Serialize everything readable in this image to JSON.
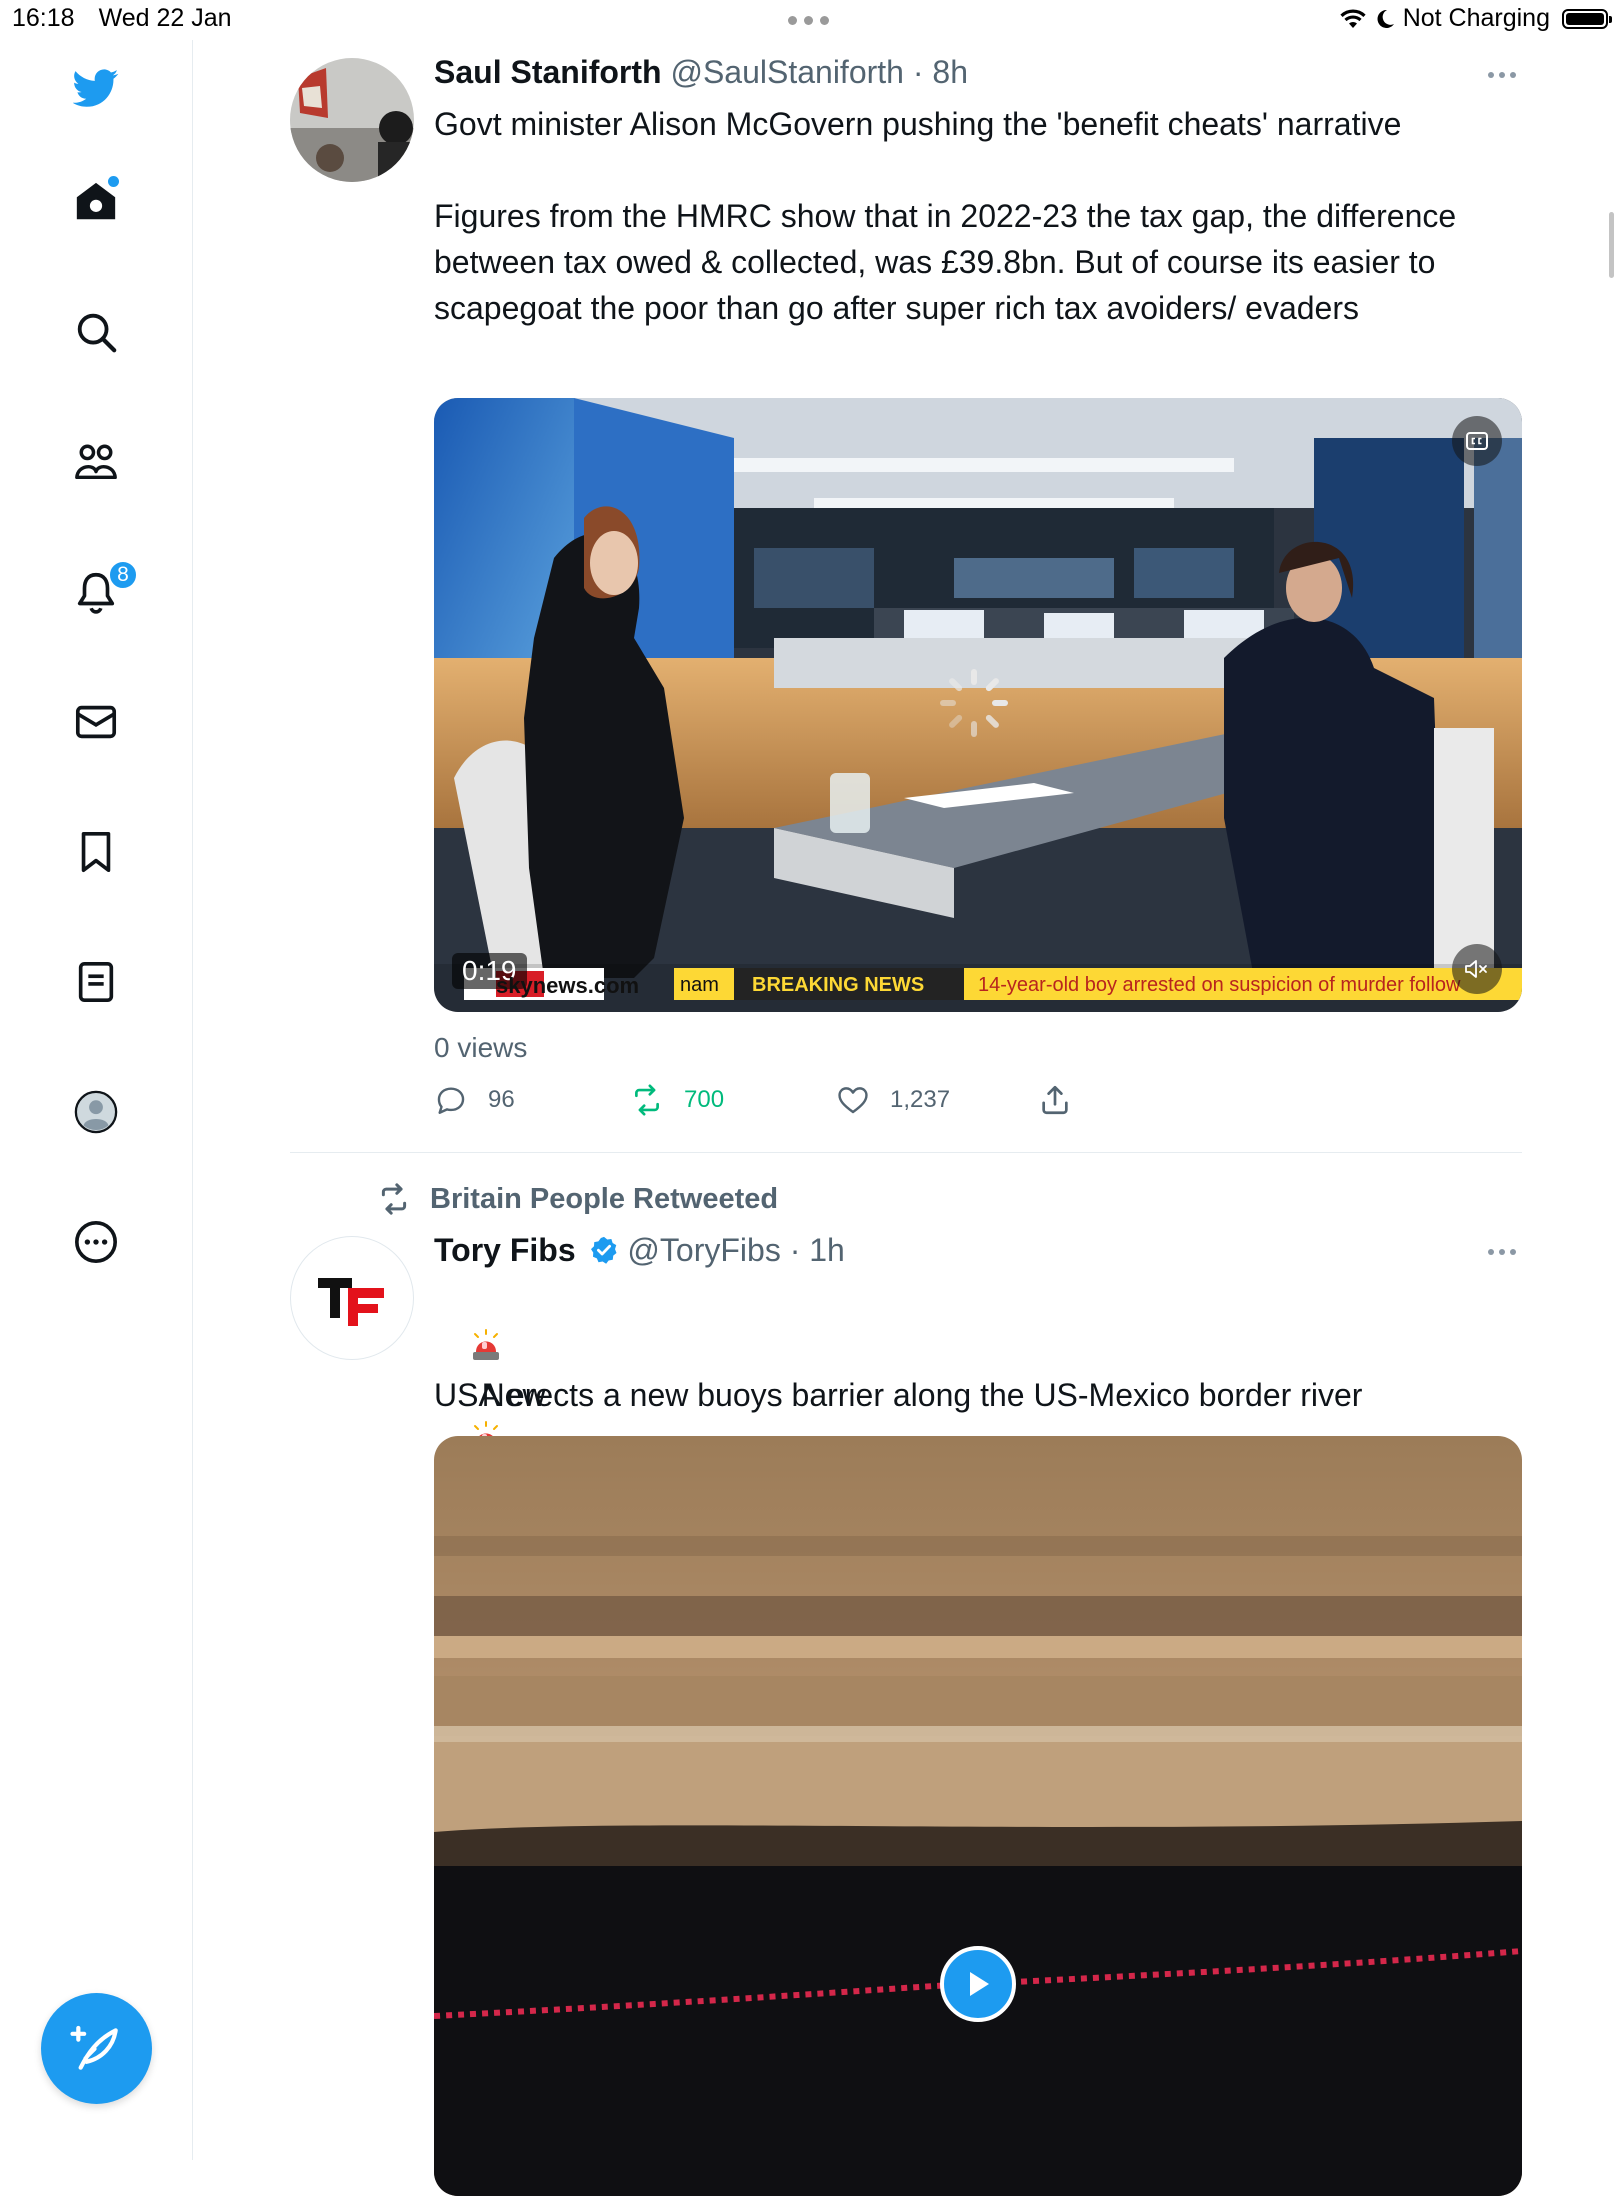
{
  "status_bar": {
    "time": "16:18",
    "date": "Wed 22 Jan",
    "charging": "Not Charging",
    "icons": [
      "wifi-icon",
      "moon-icon",
      "battery-icon"
    ]
  },
  "sidebar": {
    "notifications_badge": "8",
    "items": [
      {
        "name": "home",
        "icon": "home-icon"
      },
      {
        "name": "explore",
        "icon": "search-icon"
      },
      {
        "name": "communities",
        "icon": "people-icon"
      },
      {
        "name": "notifications",
        "icon": "bell-icon"
      },
      {
        "name": "messages",
        "icon": "envelope-icon"
      },
      {
        "name": "bookmarks",
        "icon": "bookmark-icon"
      },
      {
        "name": "lists",
        "icon": "list-icon"
      },
      {
        "name": "profile",
        "icon": "profile-icon"
      },
      {
        "name": "more",
        "icon": "more-icon"
      }
    ],
    "compose_icon": "compose-feather-icon"
  },
  "colors": {
    "accent": "#1d9bf0",
    "retweet_green": "#00ba7c",
    "secondary_text": "#536471"
  },
  "tweets": [
    {
      "display_name": "Saul Staniforth",
      "handle": "@SaulStaniforth",
      "time": "8h",
      "text": "Govt minister Alison McGovern pushing the 'benefit cheats' narrative\n\nFigures from the HMRC show that in 2022-23 the tax gap, the difference between tax owed & collected, was £39.8bn. But of course its easier to scapegoat the poor than go after super rich tax avoiders/ evaders",
      "video": {
        "duration": "0:19",
        "ticker_site": "skynews.com",
        "ticker_prefix": "nam",
        "breaking_label": "BREAKING NEWS",
        "ticker_text": "14-year-old boy arrested on suspicion of murder follow",
        "captions_icon": "cc-icon",
        "mute_icon": "mute-icon"
      },
      "views": "0 views",
      "replies": "96",
      "retweets": "700",
      "likes": "1,237"
    },
    {
      "retweeted_by": "Britain People Retweeted",
      "display_name": "Tory Fibs",
      "handle": "@ToryFibs",
      "time": "1h",
      "avatar_text": "TF",
      "new_label": "New",
      "text": "USA erects a new buoys barrier along the US-Mexico border river",
      "video": {
        "play_icon": "play-icon"
      }
    }
  ]
}
